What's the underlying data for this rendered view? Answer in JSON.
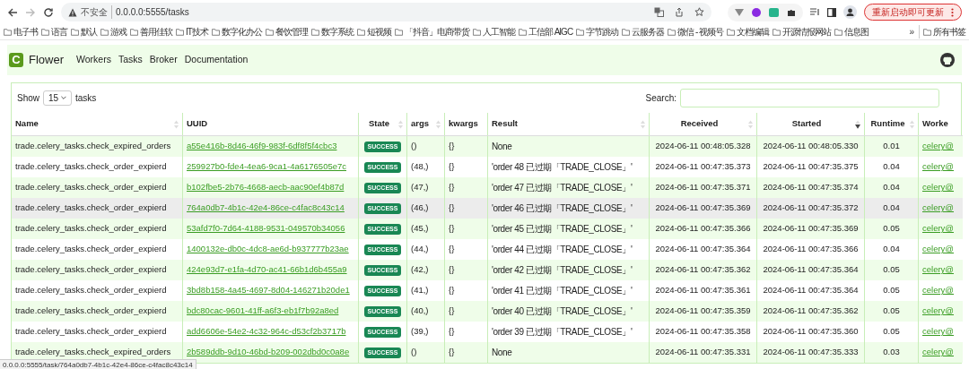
{
  "browser": {
    "security": "不安全",
    "url": "0.0.0.0:5555/tasks",
    "update_button": "重新启动即可更新",
    "bookmarks": [
      "电子书",
      "语言",
      "默认",
      "游戏",
      "善用佳软",
      "IT技术",
      "数字化办公",
      "餐饮管理",
      "数字系统",
      "短视频",
      "「抖音」电商带货",
      "人工智能",
      "工信部 AIGC",
      "字节跳动",
      "云服务器",
      "微信 - 视频号",
      "文档编辑",
      "开源情报网站",
      "信息图"
    ],
    "more": "»",
    "all_bookmarks": "所有书签"
  },
  "navbar": {
    "logo_letter": "C",
    "brand": "Flower",
    "links": [
      "Workers",
      "Tasks",
      "Broker",
      "Documentation"
    ]
  },
  "controls": {
    "show_label": "Show",
    "page_size": "15",
    "tasks_label": "tasks",
    "search_label": "Search:"
  },
  "table": {
    "columns": [
      {
        "label": "Name",
        "sortable": true,
        "sorted_descending": false
      },
      {
        "label": "UUID",
        "sortable": false
      },
      {
        "label": "State",
        "sortable": true,
        "sorted_descending": false
      },
      {
        "label": "args",
        "sortable": true,
        "sorted_descending": false
      },
      {
        "label": "kwargs",
        "sortable": false
      },
      {
        "label": "Result",
        "sortable": true,
        "sorted_descending": false
      },
      {
        "label": "Received",
        "sortable": true,
        "sorted_descending": false
      },
      {
        "label": "Started",
        "sortable": true,
        "sorted_descending": true
      },
      {
        "label": "Runtime",
        "sortable": true,
        "sorted_descending": false
      },
      {
        "label": "Worke",
        "sortable": false
      }
    ],
    "rows": [
      {
        "name": "trade.celery_tasks.check_expired_orders",
        "uuid": "a55e416b-8d46-46f9-983f-6df8f5f4cbc3",
        "state": "SUCCESS",
        "args": "()",
        "kwargs": "{}",
        "result": "None",
        "received": "2024-06-11 00:48:05.328",
        "started": "2024-06-11 00:48:05.330",
        "runtime": "0.01",
        "worker": "celery@",
        "hovered": false
      },
      {
        "name": "trade.celery_tasks.check_order_expierd",
        "uuid": "259927b0-fde4-4ea6-9ca1-4a6176505e7c",
        "state": "SUCCESS",
        "args": "(48,)",
        "kwargs": "{}",
        "result": "'order 48 已过期「TRADE_CLOSE」'",
        "received": "2024-06-11 00:47:35.373",
        "started": "2024-06-11 00:47:35.375",
        "runtime": "0.04",
        "worker": "celery@",
        "hovered": false
      },
      {
        "name": "trade.celery_tasks.check_order_expierd",
        "uuid": "b102fbe5-2b76-4668-aecb-aac90ef4b87d",
        "state": "SUCCESS",
        "args": "(47,)",
        "kwargs": "{}",
        "result": "'order 47 已过期「TRADE_CLOSE」'",
        "received": "2024-06-11 00:47:35.371",
        "started": "2024-06-11 00:47:35.374",
        "runtime": "0.04",
        "worker": "celery@",
        "hovered": false
      },
      {
        "name": "trade.celery_tasks.check_order_expierd",
        "uuid": "764a0db7-4b1c-42e4-86ce-c4fac8c43c14",
        "state": "SUCCESS",
        "args": "(46,)",
        "kwargs": "{}",
        "result": "'order 46 已过期「TRADE_CLOSE」'",
        "received": "2024-06-11 00:47:35.369",
        "started": "2024-06-11 00:47:35.372",
        "runtime": "0.04",
        "worker": "celery@",
        "hovered": true
      },
      {
        "name": "trade.celery_tasks.check_order_expierd",
        "uuid": "53afd7f0-7d64-4188-9531-049570b34056",
        "state": "SUCCESS",
        "args": "(45,)",
        "kwargs": "{}",
        "result": "'order 45 已过期「TRADE_CLOSE」'",
        "received": "2024-06-11 00:47:35.366",
        "started": "2024-06-11 00:47:35.369",
        "runtime": "0.05",
        "worker": "celery@",
        "hovered": false
      },
      {
        "name": "trade.celery_tasks.check_order_expierd",
        "uuid": "1400132e-db0c-4dc8-ae6d-b937777b23ae",
        "state": "SUCCESS",
        "args": "(44,)",
        "kwargs": "{}",
        "result": "'order 44 已过期「TRADE_CLOSE」'",
        "received": "2024-06-11 00:47:35.364",
        "started": "2024-06-11 00:47:35.366",
        "runtime": "0.04",
        "worker": "celery@",
        "hovered": false
      },
      {
        "name": "trade.celery_tasks.check_order_expierd",
        "uuid": "424e93d7-e1fa-4d70-ac41-66b1d6b455a9",
        "state": "SUCCESS",
        "args": "(42,)",
        "kwargs": "{}",
        "result": "'order 42 已过期「TRADE_CLOSE」'",
        "received": "2024-06-11 00:47:35.362",
        "started": "2024-06-11 00:47:35.364",
        "runtime": "0.05",
        "worker": "celery@",
        "hovered": false
      },
      {
        "name": "trade.celery_tasks.check_order_expierd",
        "uuid": "3bd8b158-4a45-4697-8d04-146271b20de1",
        "state": "SUCCESS",
        "args": "(41,)",
        "kwargs": "{}",
        "result": "'order 41 已过期「TRADE_CLOSE」'",
        "received": "2024-06-11 00:47:35.361",
        "started": "2024-06-11 00:47:35.364",
        "runtime": "0.05",
        "worker": "celery@",
        "hovered": false
      },
      {
        "name": "trade.celery_tasks.check_order_expierd",
        "uuid": "bdc80cac-9601-41ff-a6f3-eb1f7b92a8ed",
        "state": "SUCCESS",
        "args": "(40,)",
        "kwargs": "{}",
        "result": "'order 40 已过期「TRADE_CLOSE」'",
        "received": "2024-06-11 00:47:35.359",
        "started": "2024-06-11 00:47:35.362",
        "runtime": "0.05",
        "worker": "celery@",
        "hovered": false
      },
      {
        "name": "trade.celery_tasks.check_order_expierd",
        "uuid": "add6606e-54e2-4c32-964c-d53cf2b3717b",
        "state": "SUCCESS",
        "args": "(39,)",
        "kwargs": "{}",
        "result": "'order 39 已过期「TRADE_CLOSE」'",
        "received": "2024-06-11 00:47:35.358",
        "started": "2024-06-11 00:47:35.360",
        "runtime": "0.05",
        "worker": "celery@",
        "hovered": false
      },
      {
        "name": "trade.celery_tasks.check_expired_orders",
        "uuid": "2b589ddb-9d10-46bd-b209-002dbd0c0a8e",
        "state": "SUCCESS",
        "args": "()",
        "kwargs": "{}",
        "result": "None",
        "received": "2024-06-11 00:47:35.331",
        "started": "2024-06-11 00:47:35.333",
        "runtime": "0.03",
        "worker": "celery@",
        "hovered": false
      }
    ]
  },
  "status_url": "0.0.0.0:5555/task/764a0db7-4b1c-42e4-86ce-c4fac8c43c14"
}
